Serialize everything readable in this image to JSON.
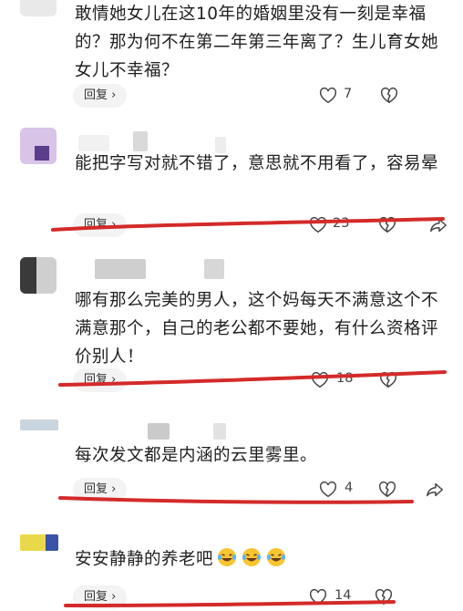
{
  "comments": [
    {
      "text": "敢情她女儿在这10年的婚姻里没有一刻是幸福的？那为何不在第二年第三年离了？生儿育女她女儿不幸福？",
      "reply_label": "回复",
      "like_count": "7"
    },
    {
      "text": "能把字写对就不错了，意思就不用看了，容易晕",
      "reply_label": "回复",
      "like_count": "23"
    },
    {
      "text": "哪有那么完美的男人，这个妈每天不满意这个不满意那个，自己的老公都不要她，有什么资格评价别人！",
      "reply_label": "回复",
      "like_count": "18"
    },
    {
      "text": "每次发文都是内涵的云里雾里。",
      "reply_label": "回复",
      "like_count": "4"
    },
    {
      "text": "安安静静的养老吧",
      "reply_label": "回复",
      "like_count": "14"
    }
  ],
  "colors": {
    "underline": "#d42a2a",
    "reply_bg": "#f3f3f3"
  },
  "icons": {
    "like": "heart-outline-icon",
    "dislike": "broken-heart-icon",
    "share": "share-arrow-icon",
    "emoji": "laugh-cry-emoji"
  }
}
